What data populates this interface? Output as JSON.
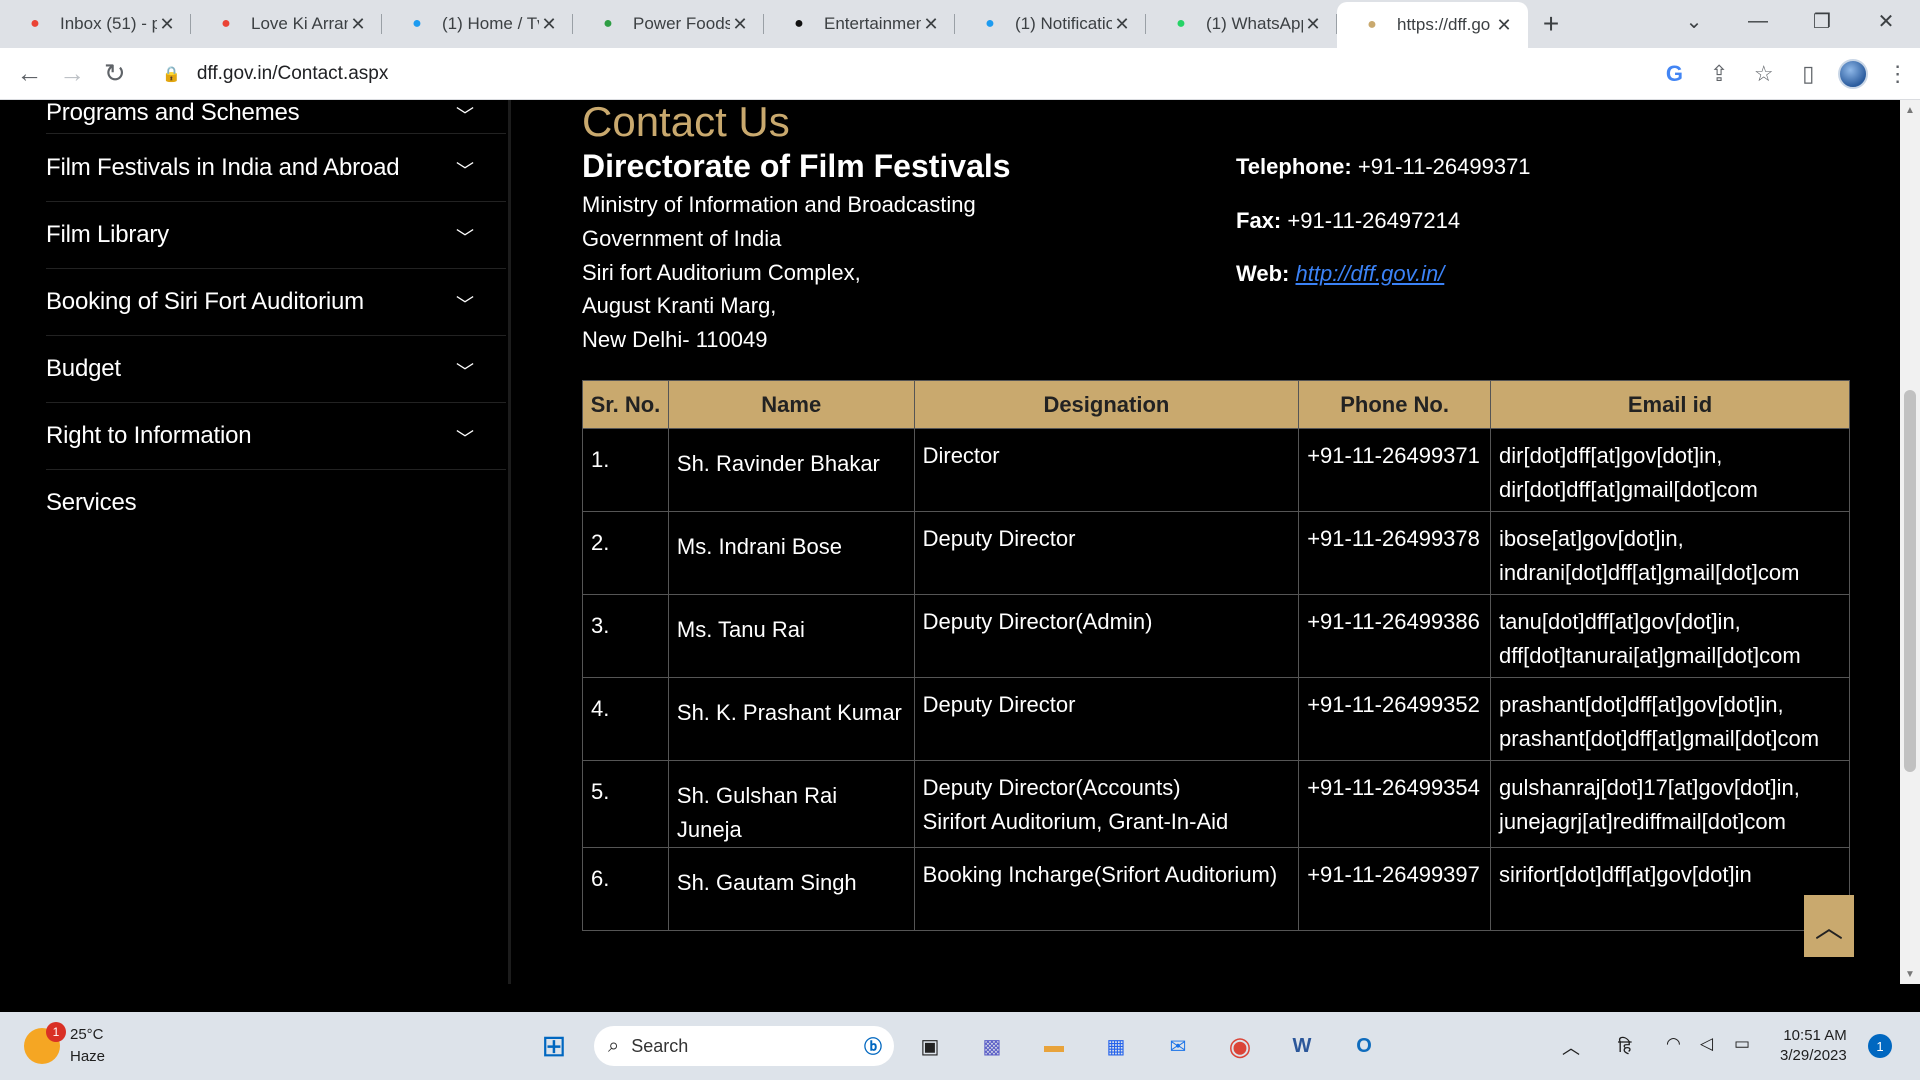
{
  "browser": {
    "tabs": [
      {
        "title": "Inbox (51) - p",
        "favicon": "gmail-50-icon",
        "color": "#ea4335"
      },
      {
        "title": "Love Ki Arran",
        "favicon": "gmail-icon",
        "color": "#ea4335"
      },
      {
        "title": "(1) Home / Tv",
        "favicon": "twitter-icon",
        "color": "#1d9bf0"
      },
      {
        "title": "Power Foods",
        "favicon": "power-foods-icon",
        "color": "#2e9e44"
      },
      {
        "title": "Entertainmen",
        "favicon": "entertainment-icon",
        "color": "#111111"
      },
      {
        "title": "(1) Notificatio",
        "favicon": "twitter-icon",
        "color": "#1d9bf0"
      },
      {
        "title": "(1) WhatsApp",
        "favicon": "whatsapp-icon",
        "color": "#25d366"
      },
      {
        "title": "https://dff.go",
        "favicon": "dff-icon",
        "color": "#c9a96e",
        "active": true
      }
    ],
    "url": "dff.gov.in/Contact.aspx"
  },
  "sidebar": {
    "items": [
      {
        "label": "Programs and Schemes",
        "has_chevron": true
      },
      {
        "label": "Film Festivals in India and Abroad",
        "has_chevron": true
      },
      {
        "label": "Film Library",
        "has_chevron": true
      },
      {
        "label": "Booking of Siri Fort Auditorium",
        "has_chevron": true
      },
      {
        "label": "Budget",
        "has_chevron": true
      },
      {
        "label": "Right to Information",
        "has_chevron": true
      },
      {
        "label": "Services",
        "has_chevron": false
      }
    ]
  },
  "contact": {
    "title": "Contact Us",
    "org": "Directorate of Film Festivals",
    "address": [
      "Ministry of Information and Broadcasting",
      "Government of India",
      "Siri fort Auditorium Complex,",
      "August Kranti Marg,",
      "New Delhi- 110049"
    ],
    "telephone_label": "Telephone:",
    "telephone": "+91-11-26499371",
    "fax_label": "Fax:",
    "fax": "+91-11-26497214",
    "web_label": "Web:",
    "web": "http://dff.gov.in/"
  },
  "table": {
    "headers": [
      "Sr. No.",
      "Name",
      "Designation",
      "Phone No.",
      "Email id"
    ],
    "rows": [
      {
        "sno": "1.",
        "name": "Sh. Ravinder Bhakar",
        "designation": [
          "Director"
        ],
        "phone": "+91-11-26499371",
        "email": [
          "dir[dot]dff[at]gov[dot]in,",
          "dir[dot]dff[at]gmail[dot]com"
        ]
      },
      {
        "sno": "2.",
        "name": "Ms. Indrani Bose",
        "designation": [
          "Deputy Director"
        ],
        "phone": "+91-11-26499378",
        "email": [
          "ibose[at]gov[dot]in,",
          "indrani[dot]dff[at]gmail[dot]com"
        ]
      },
      {
        "sno": "3.",
        "name": "Ms. Tanu Rai",
        "designation": [
          "Deputy Director(Admin)"
        ],
        "phone": "+91-11-26499386",
        "email": [
          "tanu[dot]dff[at]gov[dot]in,",
          "dff[dot]tanurai[at]gmail[dot]com"
        ]
      },
      {
        "sno": "4.",
        "name": "Sh. K. Prashant Kumar",
        "designation": [
          "Deputy Director"
        ],
        "phone": "+91-11-26499352",
        "email": [
          "prashant[dot]dff[at]gov[dot]in,",
          "prashant[dot]dff[at]gmail[dot]com"
        ]
      },
      {
        "sno": "5.",
        "name": "Sh. Gulshan Rai Juneja",
        "designation": [
          "Deputy Director(Accounts)",
          "Sirifort Auditorium, Grant-In-Aid"
        ],
        "phone": "+91-11-26499354",
        "email": [
          "gulshanraj[dot]17[at]gov[dot]in,",
          "junejagrj[at]rediffmail[dot]com"
        ]
      },
      {
        "sno": "6.",
        "name": "Sh. Gautam Singh",
        "designation": [
          "Booking Incharge(Srifort Auditorium)"
        ],
        "phone": "+91-11-26499397",
        "email": [
          "sirifort[dot]dff[at]gov[dot]in"
        ]
      }
    ]
  },
  "taskbar": {
    "weather_temp": "25°C",
    "weather_desc": "Haze",
    "weather_badge": "1",
    "search_placeholder": "Search",
    "lang": "हि",
    "time": "10:51 AM",
    "date": "3/29/2023",
    "notifications": "1"
  },
  "colors": {
    "accent_gold": "#c9a96e",
    "link_blue": "#3b82f6",
    "page_bg": "#000000"
  }
}
